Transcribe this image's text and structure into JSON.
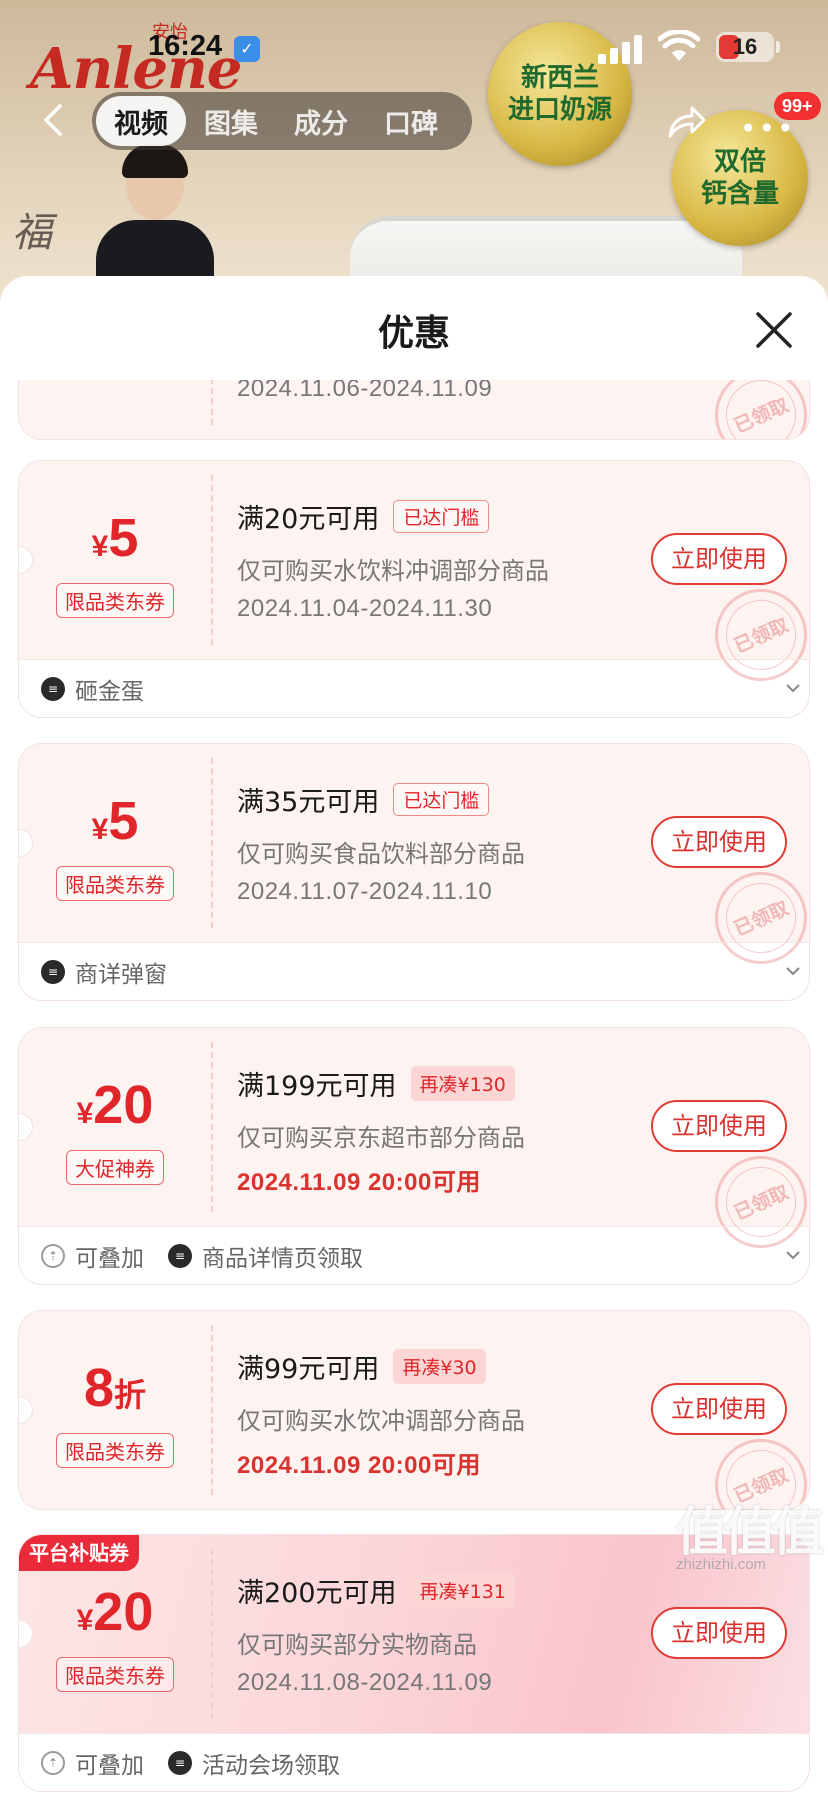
{
  "status_bar": {
    "time": "16:24",
    "battery": "16"
  },
  "background": {
    "brand": "Anlene",
    "brand_cn": "安怡",
    "badge_left": [
      "新西兰",
      "进口奶源"
    ],
    "badge_right": [
      "双倍",
      "钙含量"
    ],
    "signature": "福"
  },
  "nav": {
    "tabs": [
      {
        "label": "视频",
        "active": true
      },
      {
        "label": "图集",
        "active": false
      },
      {
        "label": "成分",
        "active": false
      },
      {
        "label": "口碑",
        "active": false
      }
    ],
    "message_badge": "99+"
  },
  "sheet": {
    "title": "优惠",
    "coupons": [
      {
        "period": "2024.11.06-2024.11.09",
        "stamp": "已领取",
        "partial": true
      },
      {
        "currency": "¥",
        "amount": "5",
        "unit": "",
        "type": "限品类东券",
        "threshold": "满20元可用",
        "status_tag": "已达门槛",
        "status_kind": "reached",
        "scope": "仅可购买水饮料冲调部分商品",
        "period": "2024.11.04-2024.11.30",
        "period_red": false,
        "button": "立即使用",
        "stamp": "已领取",
        "footer": [
          {
            "icon": "source-icon",
            "label": "砸金蛋"
          }
        ]
      },
      {
        "currency": "¥",
        "amount": "5",
        "unit": "",
        "type": "限品类东券",
        "threshold": "满35元可用",
        "status_tag": "已达门槛",
        "status_kind": "reached",
        "scope": "仅可购买食品饮料部分商品",
        "period": "2024.11.07-2024.11.10",
        "period_red": false,
        "button": "立即使用",
        "stamp": "已领取",
        "footer": [
          {
            "icon": "source-icon",
            "label": "商详弹窗"
          }
        ]
      },
      {
        "currency": "¥",
        "amount": "20",
        "unit": "",
        "type": "大促神券",
        "threshold": "满199元可用",
        "status_tag": "再凑¥130",
        "status_kind": "more",
        "scope": "仅可购买京东超市部分商品",
        "period": "2024.11.09 20:00可用",
        "period_red": true,
        "button": "立即使用",
        "stamp": "已领取",
        "footer": [
          {
            "icon": "stackable-icon",
            "label": "可叠加"
          },
          {
            "icon": "source-icon",
            "label": "商品详情页领取"
          }
        ]
      },
      {
        "currency": "",
        "amount": "8",
        "unit": "折",
        "type": "限品类东券",
        "threshold": "满99元可用",
        "status_tag": "再凑¥30",
        "status_kind": "more",
        "scope": "仅可购买水饮冲调部分商品",
        "period": "2024.11.09 20:00可用",
        "period_red": true,
        "button": "立即使用",
        "stamp": "已领取",
        "footer": []
      },
      {
        "label": "平台补贴券",
        "currency": "¥",
        "amount": "20",
        "unit": "",
        "type": "限品类东券",
        "threshold": "满200元可用",
        "status_tag": "再凑¥131",
        "status_kind": "more",
        "scope": "仅可购买部分实物商品",
        "period": "2024.11.08-2024.11.09",
        "period_red": false,
        "button": "立即使用",
        "stamp": "",
        "footer": [
          {
            "icon": "stackable-icon",
            "label": "可叠加"
          },
          {
            "icon": "source-icon",
            "label": "活动会场领取"
          }
        ]
      }
    ]
  },
  "watermark": {
    "text": "值值值",
    "url": "zhizhizhi.com"
  },
  "colors": {
    "accent_red": "#e0262a",
    "coupon_bg": "#fdf3f1",
    "platform_tag": "#ea2a39"
  }
}
